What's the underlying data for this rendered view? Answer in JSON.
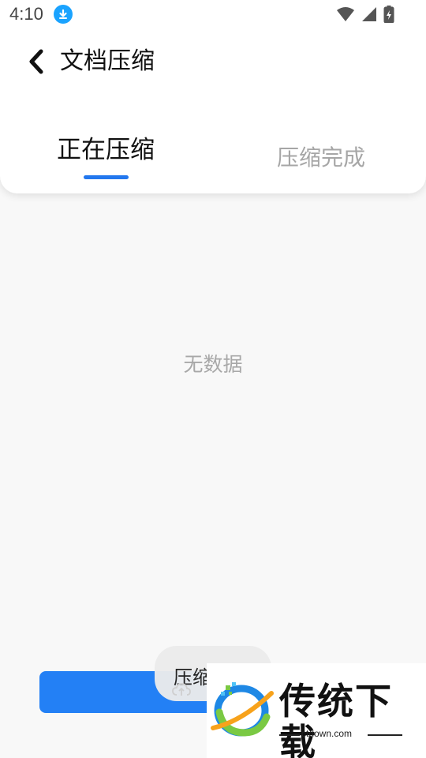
{
  "status_bar": {
    "time": "4:10",
    "icons": [
      "download-icon",
      "wifi-icon",
      "signal-icon",
      "battery-charging-icon"
    ]
  },
  "header": {
    "title": "文档压缩",
    "back_icon": "chevron-left-icon"
  },
  "tabs": [
    {
      "label": "正在压缩",
      "active": true
    },
    {
      "label": "压缩完成",
      "active": false
    }
  ],
  "colors": {
    "accent": "#2380f5",
    "background": "#f8f8f8",
    "inactive_tab": "#a6a6a6"
  },
  "main": {
    "empty_text": "无数据"
  },
  "toast": {
    "label": "压缩",
    "icon": "upload-cloud-icon"
  },
  "watermark": {
    "brand": "传统下载",
    "url": "ctdown.com"
  }
}
